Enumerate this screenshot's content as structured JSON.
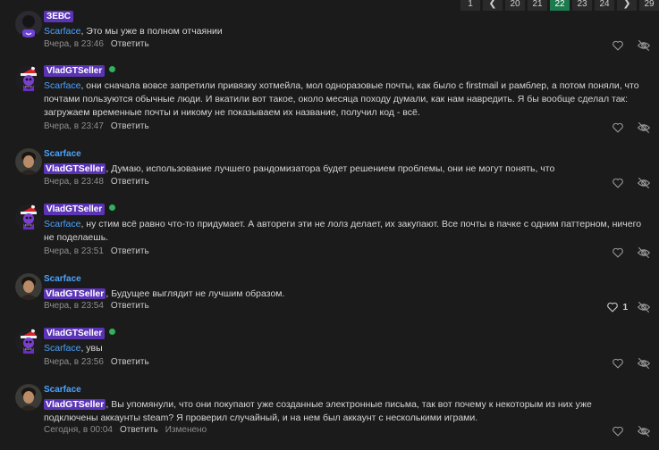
{
  "pagination": {
    "pages": [
      "1",
      "20",
      "21",
      "22",
      "23",
      "24",
      "29"
    ],
    "current": "22"
  },
  "posts": [
    {
      "author": "ЗЕВС",
      "mention": "Scarface",
      "text": ", Это мы уже в полном отчаянии",
      "time": "Вчера, в 23:46",
      "reply": "Ответить"
    },
    {
      "author": "VladGTSeller",
      "mention": "Scarface",
      "text": ", они сначала вовсе запретили привязку хотмейла, мол одноразовые почты, как было с firstmail и рамблер, а потом поняли, что почтами пользуются обычные люди. И вкатили вот такое, около месяца походу думали, как нам навредить. Я бы вообще сделал так: загружаем временные почты и никому не показываем их название, получил код - всё.",
      "time": "Вчера, в 23:47",
      "reply": "Ответить"
    },
    {
      "author": "Scarface",
      "mention": "VladGTSeller",
      "text": ", Думаю, использование лучшего рандомизатора будет решением проблемы, они не могут понять, что",
      "time": "Вчера, в 23:48",
      "reply": "Ответить"
    },
    {
      "author": "VladGTSeller",
      "mention": "Scarface",
      "text": ", ну стим всё равно что-то придумает. А автореги эти не лолз делает, их закупают. Все почты в пачке с одним паттерном, ничего не поделаешь.",
      "time": "Вчера, в 23:51",
      "reply": "Ответить"
    },
    {
      "author": "Scarface",
      "mention": "VladGTSeller",
      "text": ", Будущее выглядит не лучшим образом.",
      "time": "Вчера, в 23:54",
      "reply": "Ответить",
      "likes": "1"
    },
    {
      "author": "VladGTSeller",
      "mention": "Scarface",
      "text": ", увы",
      "time": "Вчера, в 23:56",
      "reply": "Ответить"
    },
    {
      "author": "Scarface",
      "mention": "VladGTSeller",
      "text": ", Вы упомянули, что они покупают уже созданные электронные письма, так вот почему к некоторым из них уже подключены аккаунты steam? Я проверил случайный, и на нем был аккаунт с несколькими играми.",
      "time": "Сегодня, в 00:04",
      "reply": "Ответить",
      "edited": "Изменено"
    }
  ],
  "icons": {
    "like": "heart-icon",
    "hide": "eye-off-icon",
    "online": "online-dot"
  },
  "colors": {
    "background": "#1b1b1b",
    "badge": "#5a34b5",
    "link": "#4ba3ff",
    "online": "#2fb15e",
    "page_active": "#1d7a4e"
  }
}
